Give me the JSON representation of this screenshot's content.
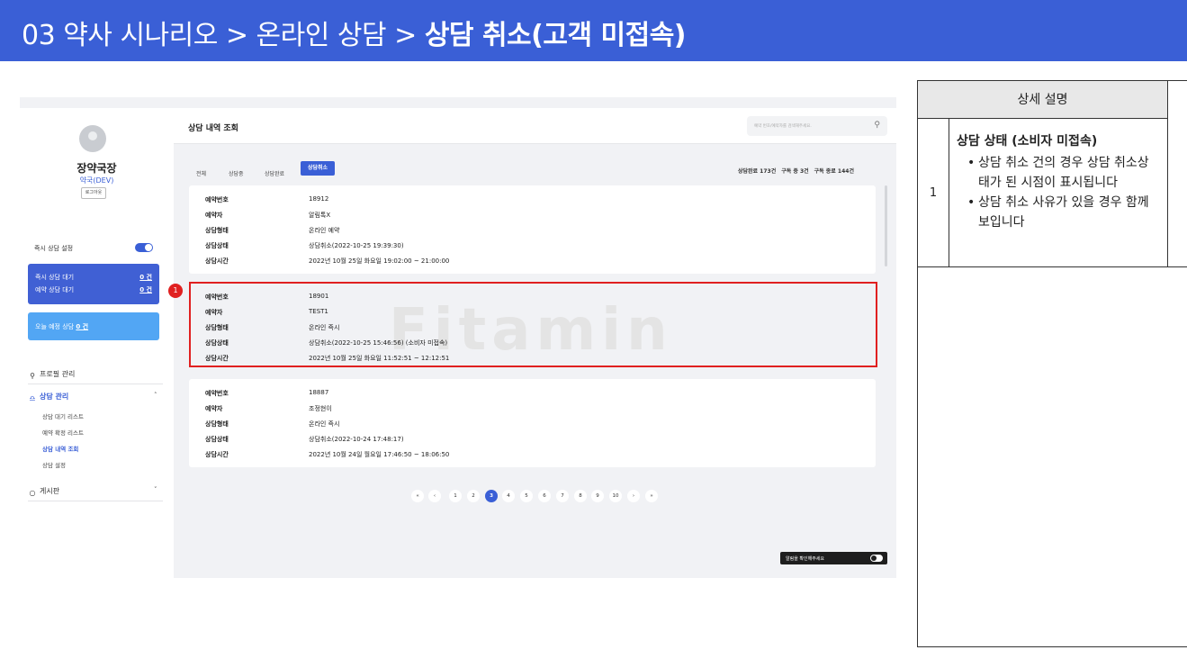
{
  "header": {
    "prefix": "03 약사 시나리오 > 온라인 상담 > ",
    "bold": "상담 취소(고객 미접속)"
  },
  "sidebar": {
    "store_name": "장약국장",
    "store_sub": "약국(DEV)",
    "logout": "로그아웃",
    "instant_label": "즉시 상담 설정",
    "wait_rows": [
      {
        "label": "즉시 상담 대기",
        "count": "0 건"
      },
      {
        "label": "예약 상담 대기",
        "count": "0 건"
      }
    ],
    "today_label": "오늘 예정 상담",
    "today_count": "0 건",
    "menu": {
      "profile": "프로필 관리",
      "consult": "상담 관리",
      "sub": [
        "상담 대기 리스트",
        "예약 확정 리스트",
        "상담 내역 조회",
        "상담 설정"
      ],
      "board": "게시판"
    }
  },
  "main": {
    "title": "상담 내역 조회",
    "search_placeholder": "예약 번호/예약자를 검색해주세요.",
    "tabs": [
      "전체",
      "상담중",
      "상담완료",
      "상담취소"
    ],
    "stats": [
      "상담완료 173건",
      "구독 중 3건",
      "구독 종료 144건"
    ],
    "labels": [
      "예약번호",
      "예약자",
      "상담형태",
      "상담상태",
      "상담시간"
    ],
    "cards": [
      {
        "values": [
          "18912",
          "알림톡X",
          "온라인 예약",
          "상담취소(2022-10-25 19:39:30)",
          "2022년 10월 25일 화요일 19:02:00 ~ 21:00:00"
        ]
      },
      {
        "values": [
          "18901",
          "TEST1",
          "온라인 즉시",
          "상담취소(2022-10-25 15:46:56) (소비자 미접속)",
          "2022년 10월 25일 화요일 11:52:51 ~ 12:12:51"
        ]
      },
      {
        "values": [
          "18887",
          "조정현이",
          "온라인 즉시",
          "상담취소(2022-10-24 17:48:17)",
          "2022년 10월 24일 월요일 17:46:50 ~ 18:06:50"
        ]
      }
    ],
    "watermark": "Fitamin",
    "badge": "1",
    "pagination": [
      "«",
      "‹",
      "1",
      "2",
      "3",
      "4",
      "5",
      "6",
      "7",
      "8",
      "9",
      "10",
      "›",
      "»"
    ],
    "notice": "알림을 확인해주세요"
  },
  "panel": {
    "header": "상세 설명",
    "num": "1",
    "heading": "상담 상태 (소비자 미접속)",
    "bullets": [
      "상담 취소 건의 경우 상담 취소상태가 된 시점이 표시됩니다",
      "상담 취소 사유가 있을 경우 함께 보입니다"
    ]
  }
}
